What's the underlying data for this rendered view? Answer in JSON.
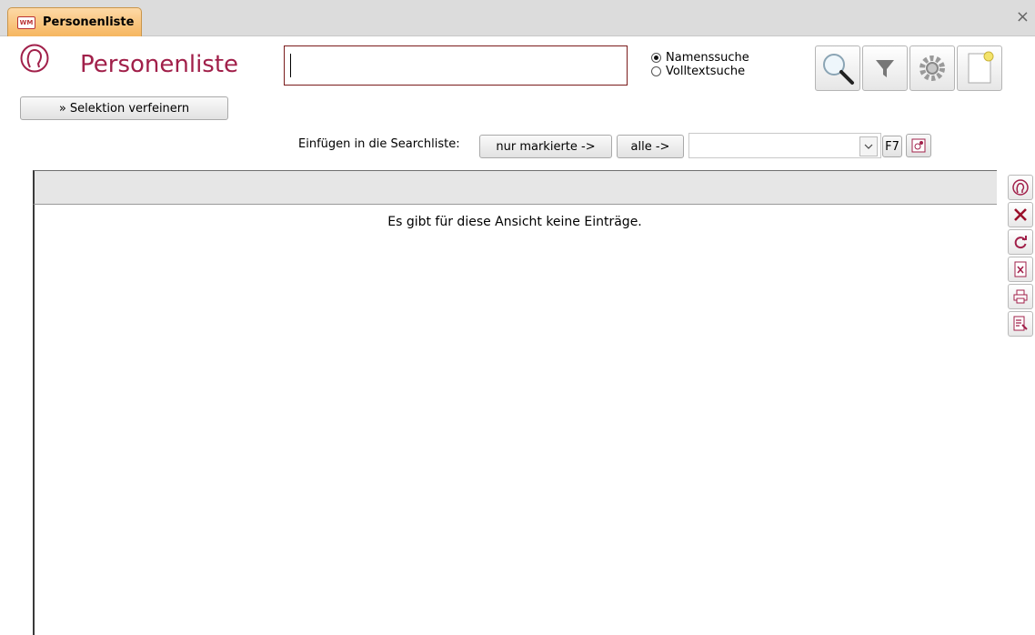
{
  "window": {
    "tab_label": "Personenliste",
    "tab_icon_text": "WM",
    "close_glyph": "×"
  },
  "header": {
    "title": "Personenliste",
    "icon": "person-head-icon",
    "refine_button": "» Selektion verfeinern"
  },
  "search": {
    "value": "",
    "modes": [
      {
        "label": "Namenssuche",
        "selected": true
      },
      {
        "label": "Volltextsuche",
        "selected": false
      }
    ]
  },
  "toolbar": {
    "buttons": [
      "search-magnifier-icon",
      "filter-funnel-icon",
      "settings-gear-icon",
      "new-document-icon"
    ]
  },
  "insert": {
    "label": "Einfügen in die Searchliste:",
    "marked_button": "nur markierte ->",
    "all_button": "alle ->",
    "combo_value": "",
    "f7_label": "F7"
  },
  "list": {
    "empty_message": "Es gibt für diese Ansicht keine Einträge."
  },
  "side_toolbar": {
    "buttons": [
      "person-icon",
      "delete-x-icon",
      "refresh-icon",
      "export-excel-icon",
      "print-icon",
      "report-icon"
    ]
  },
  "colors": {
    "accent": "#a1204a",
    "tab": "#f6b660"
  }
}
